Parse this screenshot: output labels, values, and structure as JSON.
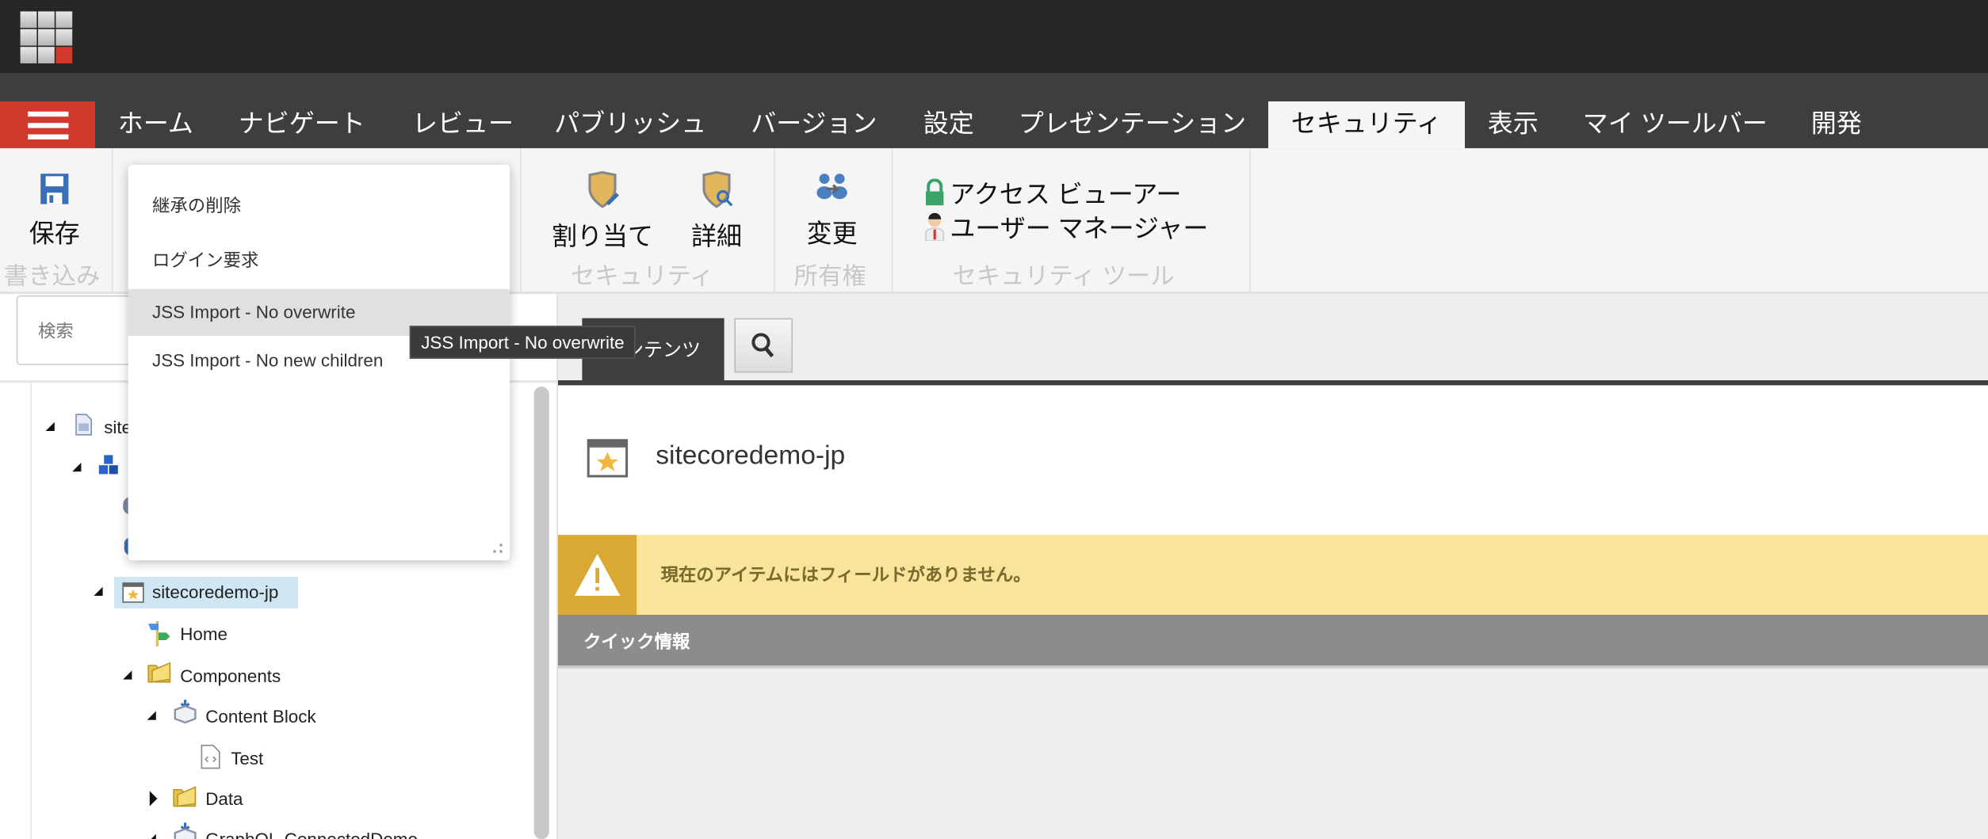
{
  "nav": {
    "tabs": [
      {
        "label": "ホーム"
      },
      {
        "label": "ナビゲート"
      },
      {
        "label": "レビュー"
      },
      {
        "label": "パブリッシュ"
      },
      {
        "label": "バージョン"
      },
      {
        "label": "設定"
      },
      {
        "label": "プレゼンテーション"
      },
      {
        "label": "セキュリティ",
        "active": true
      },
      {
        "label": "表示"
      },
      {
        "label": "マイ ツールバー"
      },
      {
        "label": "開発"
      }
    ]
  },
  "ribbon": {
    "save_label": "保存",
    "write_group": "書き込み",
    "assign_label": "割り当て",
    "details_label": "詳細",
    "security_group": "セキュリティ",
    "change_label": "変更",
    "ownership_group": "所有権",
    "access_viewer_label": "アクセス ビューアー",
    "user_manager_label": "ユーザー マネージャー",
    "security_tools_group": "セキュリティ ツール"
  },
  "menu": {
    "items": [
      {
        "label": "継承の削除"
      },
      {
        "label": "ログイン要求"
      },
      {
        "label": "JSS Import - No overwrite",
        "highlighted": true
      },
      {
        "label": "JSS Import - No new children"
      }
    ],
    "tooltip": "JSS Import - No overwrite"
  },
  "search": {
    "placeholder": "検索"
  },
  "tree": {
    "root_label": "site",
    "items": [
      {
        "label": "sitecoredemo-jp",
        "selected": true
      },
      {
        "label": "Home"
      },
      {
        "label": "Components"
      },
      {
        "label": "Content Block"
      },
      {
        "label": "Test"
      },
      {
        "label": "Data"
      },
      {
        "label": "GraphQL-ConnectedDemo"
      }
    ]
  },
  "content": {
    "tab_label": "コンテンツ",
    "item_title": "sitecoredemo-jp",
    "warning": "現在のアイテムにはフィールドがありません。",
    "quick_info": "クイック情報"
  },
  "colors": {
    "brand_red": "#d0392b",
    "warning_bg": "#f9e49b",
    "warning_accent": "#d9a934",
    "selection": "#cfe6f3"
  }
}
